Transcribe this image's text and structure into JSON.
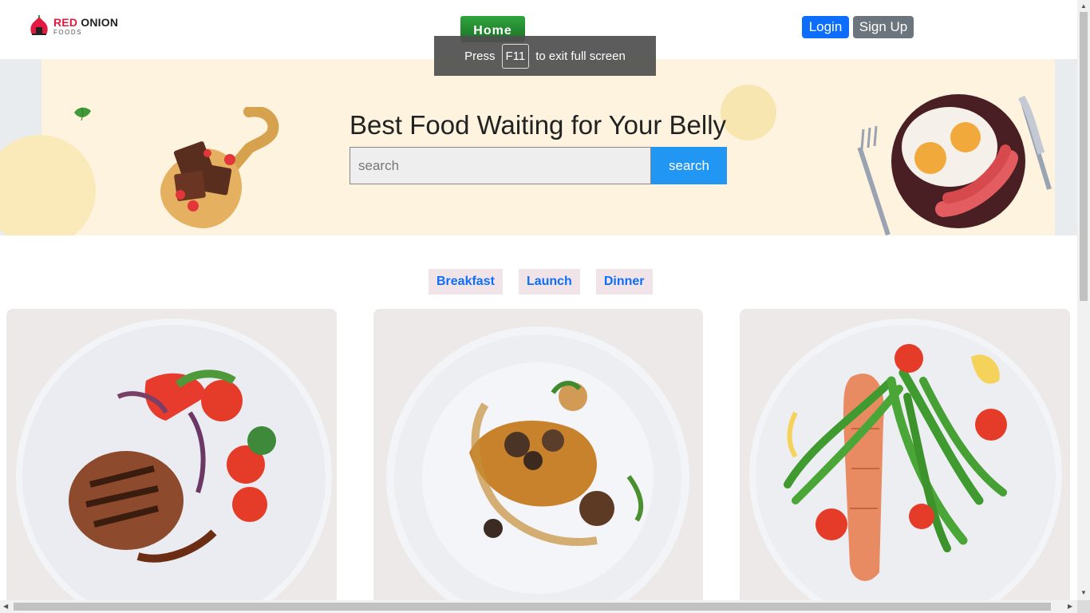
{
  "logo": {
    "brand_red": "RED",
    "brand_dark": "ONION",
    "tagline": "FOODS"
  },
  "nav": {
    "home": "Home",
    "login": "Login",
    "signup": "Sign Up"
  },
  "fullscreen_notice": {
    "prefix": "Press",
    "key": "F11",
    "suffix": "to exit full screen"
  },
  "banner": {
    "title": "Best Food Waiting for Your Belly",
    "search_placeholder": "search",
    "search_button": "search"
  },
  "tabs": [
    "Breakfast",
    "Launch",
    "Dinner"
  ],
  "colors": {
    "accent": "#0d6efd",
    "brand_red": "#e4193f",
    "home_green": "#2ea53d",
    "search_blue": "#2196f3",
    "banner_bg": "#fdf3de"
  },
  "cards": [
    {
      "icon": "grilled-steak-plate-image"
    },
    {
      "icon": "chicken-mushroom-plate-image"
    },
    {
      "icon": "salmon-asparagus-plate-image"
    }
  ]
}
